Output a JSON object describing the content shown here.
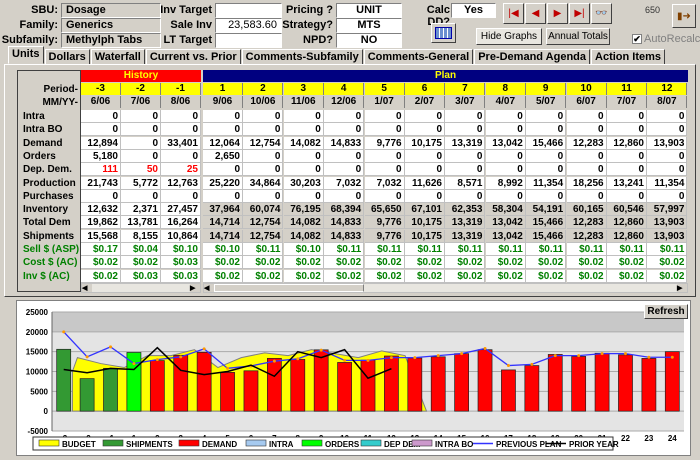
{
  "header": {
    "sbu_label": "SBU:",
    "sbu": "Dosage",
    "family_label": "Family:",
    "family": "Generics",
    "subfamily_label": "Subfamily:",
    "subfamily": "Methylph Tabs",
    "inv_target_label": "Inv Target",
    "inv_target": "",
    "sale_inv_label": "Sale Inv",
    "sale_inv": "23,583.60",
    "lt_target_label": "LT Target",
    "lt_target": "",
    "pricing_label": "Pricing ?",
    "pricing": "UNIT",
    "strategy_label": "Strategy?",
    "strategy": "MTS",
    "npd_label": "NPD?",
    "npd": "NO",
    "calc_dd_label": "Calc DD?",
    "calc_dd": "Yes",
    "record_count": "650",
    "hide_graphs": "Hide Graphs",
    "annual_totals": "Annual Totals",
    "autorecalc": "AutoRecalc",
    "autorecalc_checked": true
  },
  "tabs": [
    "Units",
    "Dollars",
    "Waterfall",
    "Current vs. Prior",
    "Comments-Subfamily",
    "Comments-General",
    "Pre-Demand Agenda",
    "Action Items"
  ],
  "grid": {
    "history_label": "History",
    "plan_label": "Plan",
    "period_label": "Period-",
    "mmyy_label": "MM/YY-",
    "periods": [
      "-3",
      "-2",
      "-1",
      "1",
      "2",
      "3",
      "4",
      "5",
      "6",
      "7",
      "8",
      "9",
      "10",
      "11",
      "12"
    ],
    "dates": [
      "6/06",
      "7/06",
      "8/06",
      "9/06",
      "10/06",
      "11/06",
      "12/06",
      "1/07",
      "2/07",
      "3/07",
      "4/07",
      "5/07",
      "6/07",
      "7/07",
      "8/07"
    ],
    "rows": [
      {
        "label": "Intra",
        "values": [
          "0",
          "0",
          "0",
          "0",
          "0",
          "0",
          "0",
          "0",
          "0",
          "0",
          "0",
          "0",
          "0",
          "0",
          "0"
        ]
      },
      {
        "label": "Intra BO",
        "values": [
          "0",
          "0",
          "0",
          "0",
          "0",
          "0",
          "0",
          "0",
          "0",
          "0",
          "0",
          "0",
          "0",
          "0",
          "0"
        ]
      },
      {
        "label": "Demand",
        "values": [
          "12,894",
          "0",
          "33,401",
          "12,064",
          "12,754",
          "14,082",
          "14,833",
          "9,776",
          "10,175",
          "13,319",
          "13,042",
          "15,466",
          "12,283",
          "12,860",
          "13,903"
        ]
      },
      {
        "label": "Orders",
        "values": [
          "5,180",
          "0",
          "0",
          "2,650",
          "0",
          "0",
          "0",
          "0",
          "0",
          "0",
          "0",
          "0",
          "0",
          "0",
          "0"
        ]
      },
      {
        "label": "Dep. Dem.",
        "values": [
          "111",
          "50",
          "25",
          "0",
          "0",
          "0",
          "0",
          "0",
          "0",
          "0",
          "0",
          "0",
          "0",
          "0",
          "0"
        ]
      },
      {
        "label": "Production",
        "values": [
          "21,743",
          "5,772",
          "12,763",
          "25,220",
          "34,864",
          "30,203",
          "7,032",
          "7,032",
          "11,626",
          "8,571",
          "8,992",
          "11,354",
          "18,256",
          "13,241",
          "11,354"
        ]
      },
      {
        "label": "Purchases",
        "values": [
          "0",
          "0",
          "0",
          "0",
          "0",
          "0",
          "0",
          "0",
          "0",
          "0",
          "0",
          "0",
          "0",
          "0",
          "0"
        ]
      },
      {
        "label": "Inventory",
        "values": [
          "12,632",
          "2,371",
          "27,457",
          "37,964",
          "60,074",
          "76,195",
          "68,394",
          "65,650",
          "67,101",
          "62,353",
          "58,304",
          "54,191",
          "60,165",
          "60,546",
          "57,997"
        ]
      },
      {
        "label": "Total Dem",
        "values": [
          "19,862",
          "13,781",
          "16,264",
          "14,714",
          "12,754",
          "14,082",
          "14,833",
          "9,776",
          "10,175",
          "13,319",
          "13,042",
          "15,466",
          "12,283",
          "12,860",
          "13,903"
        ]
      },
      {
        "label": "Shipments",
        "values": [
          "15,568",
          "8,155",
          "10,864",
          "14,714",
          "12,754",
          "14,082",
          "14,833",
          "9,776",
          "10,175",
          "13,319",
          "13,042",
          "15,466",
          "12,283",
          "12,860",
          "13,903"
        ]
      },
      {
        "label": "Sell $ (ASP)",
        "values": [
          "$0.17",
          "$0.04",
          "$0.10",
          "$0.10",
          "$0.11",
          "$0.10",
          "$0.11",
          "$0.11",
          "$0.11",
          "$0.11",
          "$0.11",
          "$0.11",
          "$0.11",
          "$0.11",
          "$0.11"
        ]
      },
      {
        "label": "Cost $ (AC)",
        "values": [
          "$0.02",
          "$0.02",
          "$0.03",
          "$0.02",
          "$0.02",
          "$0.02",
          "$0.02",
          "$0.02",
          "$0.02",
          "$0.02",
          "$0.02",
          "$0.02",
          "$0.02",
          "$0.02",
          "$0.02"
        ]
      },
      {
        "label": "Inv $ (AC)",
        "values": [
          "$0.02",
          "$0.03",
          "$0.03",
          "$0.02",
          "$0.02",
          "$0.02",
          "$0.02",
          "$0.02",
          "$0.02",
          "$0.02",
          "$0.02",
          "$0.02",
          "$0.02",
          "$0.02",
          "$0.02"
        ]
      }
    ],
    "colors": {
      "history": "#ff0000",
      "plan": "#000080",
      "period": "#ffff00",
      "dep_dem": "#ff0000",
      "money": "#008000"
    }
  },
  "refresh_label": "Refresh",
  "chart_data": {
    "type": "bar",
    "categories": [
      "-3",
      "-2",
      "-1",
      "1",
      "2",
      "3",
      "4",
      "5",
      "6",
      "7",
      "8",
      "9",
      "10",
      "11",
      "12",
      "13",
      "14",
      "15",
      "16",
      "17",
      "18",
      "19",
      "20",
      "21",
      "22",
      "23",
      "24"
    ],
    "ylim": [
      -5000,
      25000
    ],
    "yticks": [
      "25000",
      "20000",
      "15000",
      "10000",
      "5000",
      "0",
      "-5000"
    ],
    "grid": true,
    "legend": "bottom",
    "series": [
      {
        "name": "BUDGET",
        "type": "area",
        "color": "#ffff00",
        "values": [
          10000,
          13500,
          12000,
          11000,
          14000,
          14000,
          15500,
          11000,
          13500,
          14700,
          14000,
          15500,
          14500,
          13500,
          15200,
          14000,
          null,
          null,
          null,
          null,
          null,
          null,
          null,
          null,
          null,
          null,
          null
        ]
      },
      {
        "name": "SHIPMENTS",
        "type": "bar",
        "color": "#339933",
        "values": [
          15600,
          8200,
          10800,
          null,
          null,
          null,
          null,
          null,
          null,
          null,
          null,
          null,
          null,
          null,
          null,
          null,
          null,
          null,
          null,
          null,
          null,
          null,
          null,
          null,
          null,
          null,
          null
        ]
      },
      {
        "name": "DEMAND",
        "type": "bar",
        "color": "#ff0000",
        "values": [
          null,
          null,
          null,
          12064,
          12754,
          14082,
          14833,
          9776,
          10175,
          13319,
          13042,
          15466,
          12283,
          12860,
          13903,
          13400,
          13700,
          14500,
          15500,
          10400,
          11500,
          14300,
          13800,
          14600,
          14200,
          13300,
          15000
        ]
      },
      {
        "name": "INTRA",
        "type": "bar",
        "color": "#a6caf0",
        "values": []
      },
      {
        "name": "ORDERS",
        "type": "bar",
        "color": "#00ff00",
        "values": [
          null,
          null,
          null,
          14800,
          null,
          null,
          null,
          null,
          null,
          null,
          null,
          null,
          null,
          null,
          null,
          null,
          null,
          null,
          null,
          null,
          null,
          null,
          null,
          null,
          null,
          null,
          null
        ]
      },
      {
        "name": "DEP DEM",
        "type": "bar",
        "color": "#33cccc",
        "values": []
      },
      {
        "name": "INTRA BO",
        "type": "bar",
        "color": "#cc99cc",
        "values": []
      },
      {
        "name": "PREVIOUS PLAN",
        "type": "line",
        "color": "#3333ff",
        "values": [
          20000,
          13700,
          16200,
          12000,
          13000,
          13700,
          15700,
          10800,
          11400,
          12600,
          13200,
          15400,
          12800,
          12800,
          13500,
          13500,
          14000,
          14500,
          15800,
          11500,
          11800,
          14000,
          14000,
          14500,
          14500,
          13600,
          13600
        ]
      },
      {
        "name": "PRIOR YEAR",
        "type": "line",
        "color": "#000000",
        "values": [
          10500,
          9700,
          10800,
          10500,
          16000,
          10300,
          9200,
          10000,
          11600,
          8800,
          15000,
          13500,
          15500,
          8300,
          10700,
          null,
          null,
          null,
          null,
          null,
          null,
          null,
          null,
          null,
          null,
          null,
          null
        ]
      }
    ]
  }
}
